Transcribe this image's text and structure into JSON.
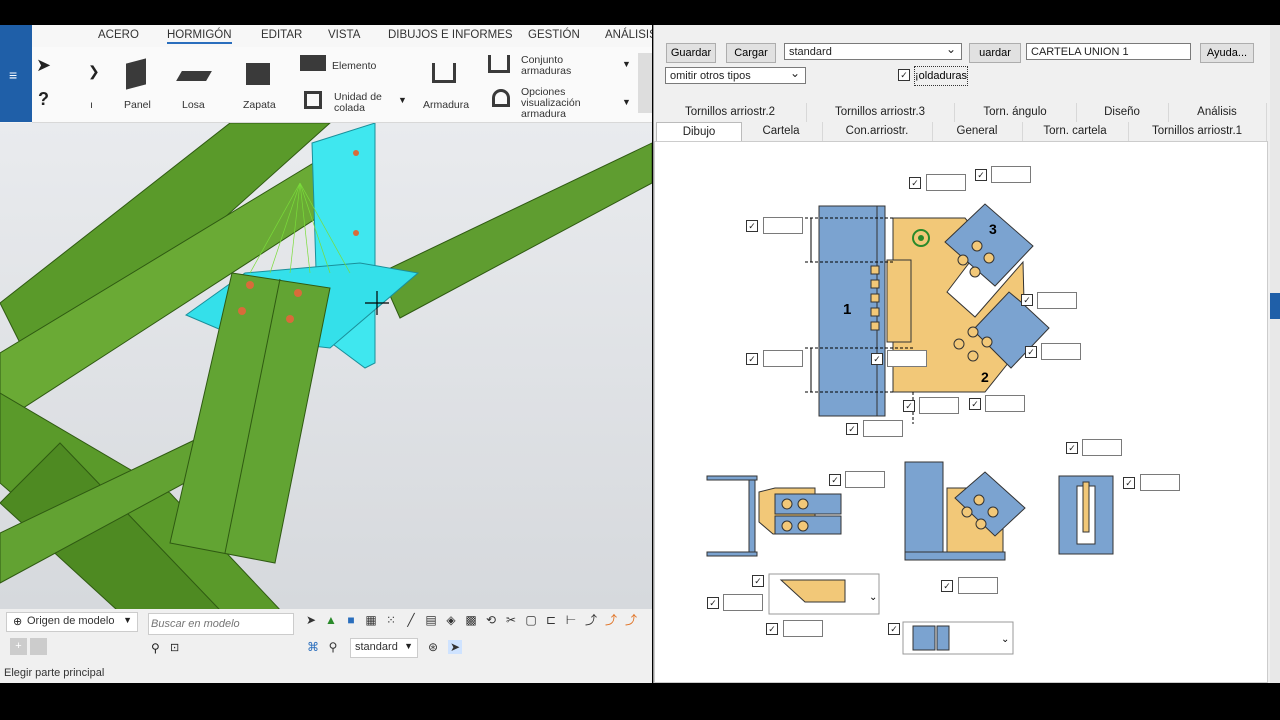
{
  "menu": {
    "items": [
      "ACERO",
      "HORMIGÓN",
      "EDITAR",
      "VISTA",
      "DIBUJOS E INFORMES",
      "GESTIÓN",
      "ANÁLISIS"
    ],
    "active": "HORMIGÓN"
  },
  "ribbon": {
    "panel": "Panel",
    "losa": "Losa",
    "zapata": "Zapata",
    "elemento": "Elemento",
    "unidad_colada_1": "Unidad de",
    "unidad_colada_2": "colada",
    "armadura": "Armadura",
    "conjunto_1": "Conjunto",
    "conjunto_2": "armaduras",
    "opciones_1": "Opciones",
    "opciones_2": "visualización",
    "opciones_3": "armadura",
    "cut_label": "ı"
  },
  "bottom": {
    "origen": "Origen de modelo",
    "search_placeholder": "Buscar en modelo",
    "standard": "standard",
    "status": "Elegir parte principal"
  },
  "dialog": {
    "guardar": "Guardar",
    "cargar": "Cargar",
    "preset": "standard",
    "guardar_con": "uardar con",
    "union_name": "CARTELA UNION 1",
    "ayuda": "Ayuda...",
    "omitir": "omitir otros tipos",
    "soldaduras": "¡oldaduras",
    "tabs_row1": [
      "Tornillos arriostr.2",
      "Tornillos arriostr.3",
      "Torn. ángulo",
      "Diseño",
      "Análisis"
    ],
    "tabs_row2": [
      "Dibujo",
      "Cartela",
      "Con.arriostr.",
      "General",
      "Torn. cartela",
      "Tornillos arriostr.1"
    ],
    "active_tab": "Dibujo"
  },
  "diagram": {
    "label_1": "1",
    "label_2": "2",
    "label_3": "3"
  },
  "colors": {
    "steel_green": "#5a9a2a",
    "plate_cyan": "#35e6f0",
    "column_blue": "#7ba3d0",
    "gusset": "#f2c878",
    "accent": "#1f5fa8"
  }
}
